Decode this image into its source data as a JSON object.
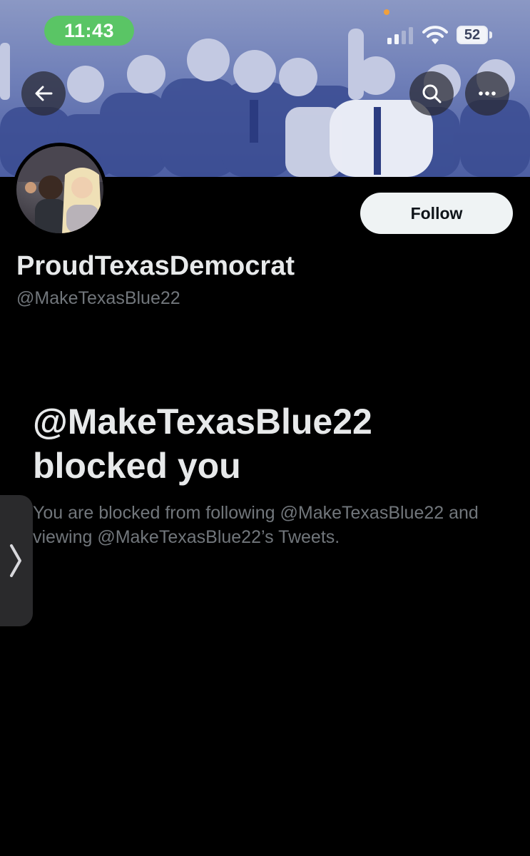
{
  "status_bar": {
    "time": "11:43",
    "battery": "52",
    "time_pill_color": "#5ac565"
  },
  "header": {
    "back_icon": "arrow-left-icon",
    "search_icon": "search-icon",
    "more_icon": "more-horizontal-icon"
  },
  "profile": {
    "display_name": "ProudTexasDemocrat",
    "handle": "@MakeTexasBlue22",
    "follow_label": "Follow"
  },
  "blocked": {
    "title": "@MakeTexasBlue22 blocked you",
    "description": "You are blocked from following @MakeTexasBlue22 and viewing @MakeTexasBlue22’s Tweets."
  },
  "side_tab": {
    "icon": "chevron-right-icon"
  },
  "colors": {
    "background": "#000000",
    "text_primary": "#e7e9ea",
    "text_secondary": "#71767b",
    "follow_button_bg": "#eff3f4"
  }
}
